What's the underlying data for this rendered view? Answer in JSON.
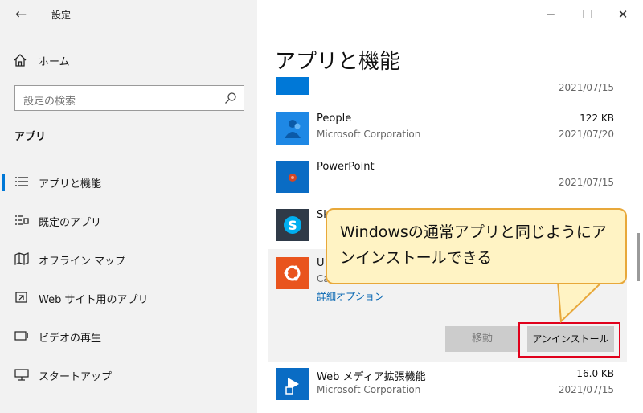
{
  "window": {
    "title": "設定",
    "back_glyph": "←",
    "minimize_glyph": "─",
    "maximize_glyph": "☐",
    "close_glyph": "✕"
  },
  "sidebar": {
    "home_label": "ホーム",
    "search_placeholder": "設定の検索",
    "section_heading": "アプリ",
    "items": [
      {
        "label": "アプリと機能",
        "icon": "list-icon",
        "selected": true
      },
      {
        "label": "既定のアプリ",
        "icon": "default-apps-icon",
        "selected": false
      },
      {
        "label": "オフライン マップ",
        "icon": "map-icon",
        "selected": false
      },
      {
        "label": "Web サイト用のアプリ",
        "icon": "web-app-icon",
        "selected": false
      },
      {
        "label": "ビデオの再生",
        "icon": "video-icon",
        "selected": false
      },
      {
        "label": "スタートアップ",
        "icon": "startup-icon",
        "selected": false
      }
    ]
  },
  "main": {
    "page_title": "アプリと機能",
    "apps": [
      {
        "name": "",
        "publisher": "",
        "size": "",
        "date": "2021/07/15",
        "icon": "partial-app-icon"
      },
      {
        "name": "People",
        "publisher": "Microsoft Corporation",
        "size": "122 KB",
        "date": "2021/07/20",
        "icon": "people-icon"
      },
      {
        "name": "PowerPoint",
        "publisher": "",
        "size": "",
        "date": "2021/07/15",
        "icon": "powerpoint-icon"
      },
      {
        "name": "Sk",
        "publisher": "",
        "size": "",
        "date": "",
        "icon": "skype-icon"
      },
      {
        "name": "U",
        "publisher": "Can",
        "size": "",
        "date": "",
        "icon": "ubuntu-icon"
      },
      {
        "name": "Web メディア拡張機能",
        "publisher": "Microsoft Corporation",
        "size": "16.0 KB",
        "date": "2021/07/15",
        "icon": "web-media-icon"
      }
    ],
    "advanced_options": "詳細オプション",
    "move_button": "移動",
    "uninstall_button": "アンインストール"
  },
  "callout": {
    "text": "Windowsの通常アプリと同じようにアンインストールできる"
  },
  "colors": {
    "accent": "#0078d7",
    "highlight_border": "#e0001b",
    "callout_fill": "#fff3c4",
    "callout_border": "#e8a83a"
  }
}
